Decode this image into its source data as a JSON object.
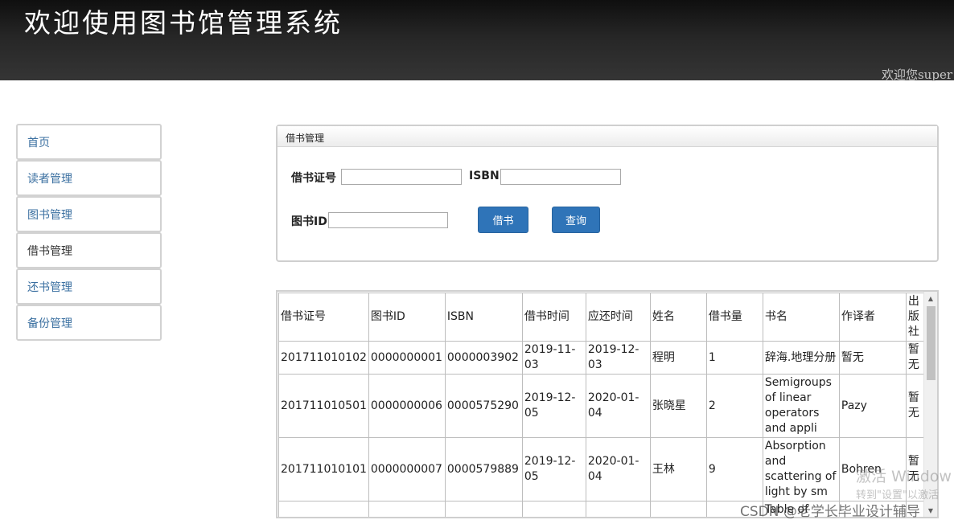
{
  "header": {
    "title": "欢迎使用图书馆管理系统",
    "welcome": "欢迎您super"
  },
  "sidebar": {
    "items": [
      {
        "label": "首页"
      },
      {
        "label": "读者管理"
      },
      {
        "label": "图书管理"
      },
      {
        "label": "借书管理"
      },
      {
        "label": "还书管理"
      },
      {
        "label": "备份管理"
      }
    ]
  },
  "panel": {
    "title": "借书管理",
    "card_label": "借书证号",
    "card_value": "",
    "isbn_label": "ISBN",
    "isbn_value": "",
    "bookid_label": "图书ID",
    "bookid_value": "",
    "borrow_button": "借书",
    "query_button": "查询"
  },
  "table": {
    "headers": [
      "借书证号",
      "图书ID",
      "ISBN",
      "借书时间",
      "应还时间",
      "姓名",
      "借书量",
      "书名",
      "作译者",
      "出版社"
    ],
    "rows": [
      [
        "201711010102",
        "0000000001",
        "0000003902",
        "2019-11-03",
        "2019-12-03",
        "程明",
        "1",
        "辞海.地理分册",
        "暂无",
        "暂无"
      ],
      [
        "201711010501",
        "0000000006",
        "0000575290",
        "2019-12-05",
        "2020-01-04",
        "张晓星",
        "2",
        "Semigroups of linear operators and appli",
        "Pazy",
        "暂无"
      ],
      [
        "201711010101",
        "0000000007",
        "0000579889",
        "2019-12-05",
        "2020-01-04",
        "王林",
        "9",
        "Absorption and scattering of light by sm",
        "Bohren",
        "暂无"
      ],
      [
        "",
        "",
        "",
        "",
        "",
        "",
        "",
        "Table of",
        "",
        ""
      ]
    ]
  },
  "overlay": {
    "activate_line1": "激活 Window",
    "activate_line2": "转到\"设置\"以激活",
    "csdn": "CSDN @老学长毕业设计辅导"
  },
  "icons": {
    "scroll_up": "scroll-up-arrow-icon",
    "scroll_down": "scroll-down-arrow-icon"
  },
  "colors": {
    "accent": "#2f74b8",
    "link": "#3a6fa0",
    "header_dark": "#1a1a1a"
  }
}
